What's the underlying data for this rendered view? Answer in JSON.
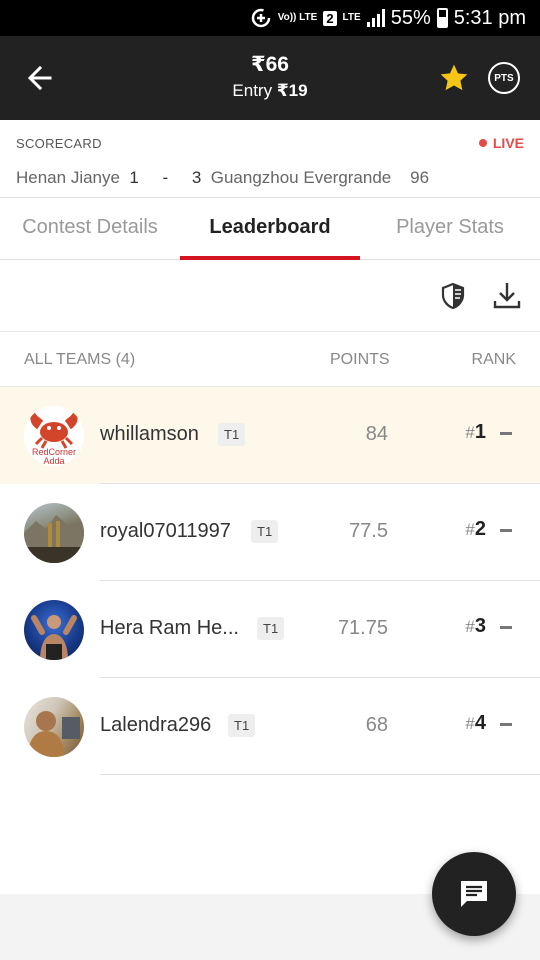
{
  "status_bar": {
    "volte": "Vo)) LTE",
    "sim": "2",
    "network": "LTE",
    "battery": "55%",
    "time": "5:31 pm"
  },
  "header": {
    "prize": "₹66",
    "entry_label": "Entry",
    "entry_value": "₹19",
    "pts_label": "PTS",
    "star_color": "#f5c518"
  },
  "scorecard": {
    "label": "SCORECARD",
    "live": "LIVE",
    "team1": "Henan Jianye",
    "team1_score": "1",
    "separator": "-",
    "team2_score": "3",
    "team2": "Guangzhou Evergrande",
    "minute": "96"
  },
  "tabs": [
    {
      "label": "Contest Details",
      "active": false
    },
    {
      "label": "Leaderboard",
      "active": true
    },
    {
      "label": "Player Stats",
      "active": false
    }
  ],
  "list_header": {
    "teams": "ALL TEAMS (4)",
    "points": "POINTS",
    "rank": "RANK"
  },
  "rows": [
    {
      "name": "whillamson",
      "team": "T1",
      "points": "84",
      "rank_hash": "#",
      "rank": "1",
      "avatar": "redcorner-crab-avatar",
      "avatar_text": "RedCorner Adda"
    },
    {
      "name": "royal07011997",
      "team": "T1",
      "points": "77.5",
      "rank_hash": "#",
      "rank": "2",
      "avatar": "landscape-photo-avatar"
    },
    {
      "name": "Hera Ram He...",
      "team": "T1",
      "points": "71.75",
      "rank_hash": "#",
      "rank": "3",
      "avatar": "wrestler-photo-avatar"
    },
    {
      "name": "Lalendra296",
      "team": "T1",
      "points": "68",
      "rank_hash": "#",
      "rank": "4",
      "avatar": "person-photo-avatar"
    }
  ],
  "colors": {
    "accent": "#d4141e",
    "live": "#e34a4a",
    "header_bg": "#222222",
    "highlight_row": "#fdf8e9"
  }
}
